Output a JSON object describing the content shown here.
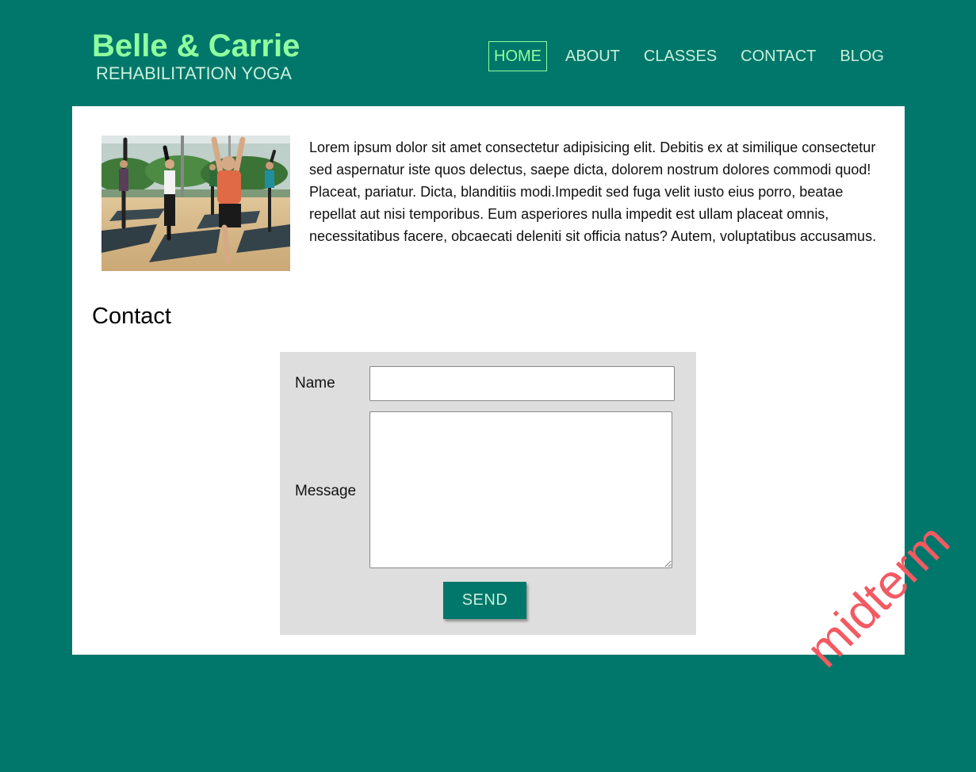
{
  "header": {
    "brand_title": "Belle & Carrie",
    "brand_subtitle": "REHABILITATION YOGA",
    "brand_color": "#8fff9f",
    "background_color": "#00776a"
  },
  "nav": {
    "items": [
      {
        "label": "HOME",
        "active": true
      },
      {
        "label": "ABOUT",
        "active": false
      },
      {
        "label": "CLASSES",
        "active": false
      },
      {
        "label": "CONTACT",
        "active": false
      },
      {
        "label": "BLOG",
        "active": false
      }
    ]
  },
  "main": {
    "photo": "yoga-class-photo",
    "intro_text": "Lorem ipsum dolor sit amet consectetur adipisicing elit. Debitis ex at similique consectetur sed aspernatur iste quos delectus, saepe dicta, dolorem nostrum dolores commodi quod! Placeat, pariatur. Dicta, blanditiis modi.Impedit sed fuga velit iusto eius porro, beatae repellat aut nisi temporibus. Eum asperiores nulla impedit est ullam placeat omnis, necessitatibus facere, obcaecati deleniti sit officia natus? Autem, voluptatibus accusamus.",
    "contact_heading": "Contact"
  },
  "form": {
    "name_label": "Name",
    "name_value": "",
    "message_label": "Message",
    "message_value": "",
    "send_label": "SEND"
  },
  "overlay": {
    "stamp_text": "midterm",
    "stamp_color": "#f25a62"
  }
}
